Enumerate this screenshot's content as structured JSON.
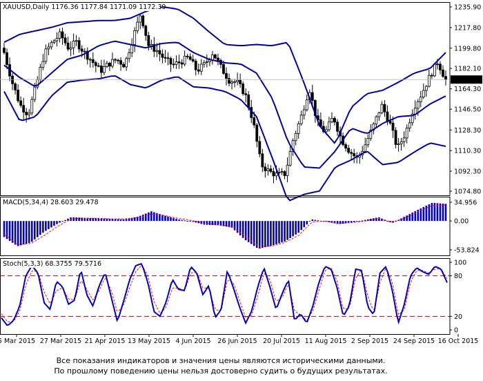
{
  "chart_data": [
    {
      "type": "candlestick",
      "symbol": "XAUUSD,Daily",
      "ohlc_header": "1176.36 1177.84 1171.09 1172.39",
      "last_price": "1172.39",
      "ylim": [
        1074.8,
        1240
      ],
      "y_ticks": [
        "1235.90",
        "1217.80",
        "1199.80",
        "1182.10",
        "1164.30",
        "1146.50",
        "1128.30",
        "1110.30",
        "1092.30",
        "1074.80"
      ],
      "x_ticks": [
        "5 Mar 2015",
        "27 Mar 2015",
        "21 Apr 2015",
        "13 May 2015",
        "4 Jun 2015",
        "26 Jun 2015",
        "20 Jul 2015",
        "11 Aug 2015",
        "2 Sep 2015",
        "24 Sep 2015",
        "16 Oct 2015"
      ],
      "close_anchors": [
        1196,
        1170,
        1150,
        1142,
        1168,
        1195,
        1205,
        1212,
        1200,
        1205,
        1196,
        1188,
        1180,
        1186,
        1190,
        1185,
        1208,
        1230,
        1202,
        1198,
        1190,
        1185,
        1188,
        1192,
        1180,
        1186,
        1196,
        1183,
        1172,
        1170,
        1160,
        1136,
        1098,
        1092,
        1089,
        1090,
        1120,
        1140,
        1165,
        1135,
        1126,
        1140,
        1120,
        1110,
        1103,
        1116,
        1132,
        1150,
        1135,
        1112,
        1126,
        1148,
        1160,
        1175,
        1188,
        1172
      ],
      "bollinger": {
        "upper": [
          1205,
          1212,
          1215,
          1218,
          1222,
          1223,
          1224,
          1224,
          1226,
          1232,
          1236,
          1234,
          1226,
          1214,
          1203,
          1202,
          1203,
          1202,
          1205,
          1170,
          1132,
          1116,
          1148,
          1160,
          1163,
          1170,
          1178,
          1182,
          1196
        ],
        "middle": [
          1185,
          1174,
          1166,
          1178,
          1190,
          1194,
          1202,
          1206,
          1203,
          1200,
          1204,
          1205,
          1196,
          1190,
          1187,
          1186,
          1178,
          1156,
          1118,
          1096,
          1095,
          1110,
          1130,
          1125,
          1134,
          1140,
          1141,
          1151,
          1158
        ],
        "lower": [
          1162,
          1136,
          1140,
          1158,
          1170,
          1172,
          1173,
          1176,
          1168,
          1165,
          1172,
          1175,
          1166,
          1165,
          1162,
          1155,
          1140,
          1104,
          1066,
          1072,
          1075,
          1096,
          1102,
          1110,
          1098,
          1100,
          1109,
          1117,
          1114
        ]
      }
    },
    {
      "type": "bar",
      "indicator_label": "MACD(5,34,4) 28.603 29.478",
      "ylim": [
        -53.824,
        34.956
      ],
      "y_ticks": [
        "34.956",
        "0.00",
        "-53.824"
      ],
      "histogram_anchors": [
        -30,
        -47,
        -40,
        -20,
        -5,
        7,
        6,
        5,
        4,
        3,
        8,
        18,
        10,
        3,
        -1,
        -7,
        -8,
        -12,
        -35,
        -52,
        -46,
        -38,
        -22,
        3,
        -1,
        -6,
        -3,
        2,
        7,
        -4,
        9,
        22,
        34,
        32
      ],
      "signal_anchors": [
        -25,
        -44,
        -42,
        -27,
        -10,
        4,
        5,
        5,
        4,
        4,
        6,
        13,
        10,
        5,
        1,
        -4,
        -7,
        -10,
        -28,
        -47,
        -47,
        -40,
        -27,
        -2,
        0,
        -4,
        -3,
        0,
        5,
        -2,
        6,
        18,
        29,
        30
      ]
    },
    {
      "type": "line",
      "indicator_label": "Stoch(5,3,3) 68.3755 79.5716",
      "ylim": [
        0,
        100
      ],
      "y_ticks": [
        "100",
        "80",
        "20",
        "0"
      ],
      "levels": [
        80,
        20
      ],
      "main_anchors": [
        18,
        6,
        14,
        35,
        80,
        95,
        84,
        40,
        30,
        72,
        64,
        38,
        44,
        90,
        52,
        35,
        65,
        85,
        48,
        12,
        42,
        74,
        95,
        98,
        70,
        27,
        20,
        42,
        75,
        60,
        58,
        94,
        84,
        52,
        66,
        18,
        30,
        88,
        62,
        34,
        10,
        28,
        64,
        92,
        63,
        30,
        54,
        74,
        14,
        24,
        10,
        35,
        70,
        94,
        90,
        62,
        20,
        36,
        90,
        88,
        34,
        22,
        84,
        94,
        60,
        10,
        38,
        80,
        92,
        86,
        82,
        94,
        90,
        70
      ],
      "signal_anchors": [
        24,
        12,
        12,
        28,
        66,
        88,
        86,
        56,
        38,
        58,
        62,
        46,
        44,
        74,
        60,
        44,
        58,
        78,
        58,
        26,
        36,
        62,
        86,
        96,
        80,
        42,
        24,
        34,
        62,
        62,
        58,
        84,
        86,
        62,
        62,
        30,
        28,
        74,
        70,
        44,
        18,
        22,
        50,
        84,
        74,
        42,
        48,
        68,
        28,
        22,
        14,
        28,
        58,
        88,
        92,
        72,
        30,
        32,
        76,
        90,
        50,
        26,
        70,
        92,
        72,
        22,
        30,
        70,
        88,
        88,
        84,
        90,
        90,
        76
      ]
    }
  ],
  "disclaimer": [
    "Все показания индикаторов и значения цены являются историческими данными.",
    "По прошлому поведению цены нельзя достоверно судить о будущих результатах."
  ],
  "colors": {
    "candles": "#000000",
    "bands": "#0000a0",
    "macd_bars": "#0000d0",
    "signal": "#ff0000",
    "stoch_main": "#0000c0",
    "levels": "#c00000"
  }
}
